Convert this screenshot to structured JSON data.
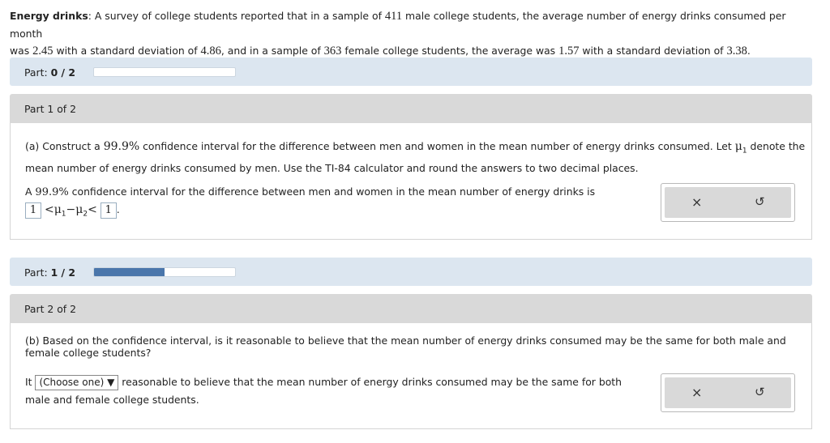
{
  "problem": {
    "title": "Energy drinks",
    "text_1": ": A survey of college students reported that in a sample of ",
    "n1": "411",
    "text_2": " male college students, the average number of energy drinks consumed per month",
    "text_3": "was ",
    "mean1": "2.45",
    "text_4": " with a standard deviation of ",
    "sd1": "4.86",
    "text_5": ", and in a sample of ",
    "n2": "363",
    "text_6": " female college students, the average was ",
    "mean2": "1.57",
    "text_7": " with a standard deviation of ",
    "sd2": "3.38",
    "text_8": "."
  },
  "part_progress_1": {
    "label": "Part: ",
    "value": "0 / 2",
    "fraction": 0.0
  },
  "part1": {
    "header": "Part 1 of 2",
    "question_line1_a": "(a) Construct a ",
    "conf": "99.9%",
    "question_line1_b": " confidence interval for the difference between men and women in the mean number of energy drinks consumed. Let ",
    "mu1": "μ",
    "mu1_sub": "1",
    "question_line1_c": " denote the",
    "question_line2": "mean number of energy drinks consumed by men. Use the TI-84 calculator and round the answers to two decimal places.",
    "answer_intro_a": "A ",
    "answer_intro_conf": "99.9%",
    "answer_intro_b": " confidence interval for the difference between men and women in the mean number of energy drinks is",
    "lower_value": "1",
    "upper_value": "1",
    "lt1": "<",
    "mu_a": "μ",
    "sub_a": "1",
    "minus": "−",
    "mu_b": "μ",
    "sub_b": "2",
    "lt2": "<",
    "period": "."
  },
  "part_progress_2": {
    "label": "Part: ",
    "value": "1 / 2",
    "fraction": 0.5
  },
  "part2": {
    "header": "Part 2 of 2",
    "question_line1": "(b) Based on the confidence interval, is it reasonable to believe that the mean number of energy drinks consumed may be the same for both male and",
    "question_line2": "female college students?",
    "answer_it": "It ",
    "select_value": "(Choose one)",
    "select_arrow": "▼",
    "answer_rest": " reasonable to believe that the mean number of energy drinks consumed may be the same for both",
    "answer_line2": "male and female college students."
  },
  "tools": {
    "clear": "×",
    "undo": "↺"
  }
}
